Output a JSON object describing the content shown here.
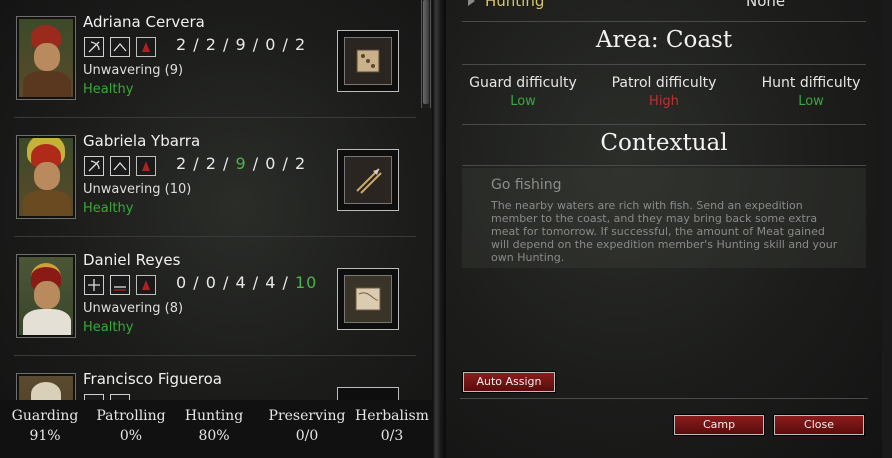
{
  "roster": [
    {
      "name": "Adriana Cervera",
      "stats": [
        "2",
        "2",
        "9",
        "0",
        "2"
      ],
      "green_stat": -1,
      "trait": "Unwavering (9)",
      "health": "Healthy",
      "item_icon": "dice-icon"
    },
    {
      "name": "Gabriela Ybarra",
      "stats": [
        "2",
        "2",
        "9",
        "0",
        "2"
      ],
      "green_stat": 2,
      "trait": "Unwavering (10)",
      "health": "Healthy",
      "item_icon": "spear-icon"
    },
    {
      "name": "Daniel Reyes",
      "stats": [
        "0",
        "0",
        "4",
        "4",
        "10"
      ],
      "green_stat": 4,
      "trait": "Unwavering (8)",
      "health": "Healthy",
      "item_icon": "map-icon"
    },
    {
      "name": "Francisco Figueroa"
    }
  ],
  "bottom_stats": [
    {
      "label": "Guarding",
      "value": "91%"
    },
    {
      "label": "Patrolling",
      "value": "0%"
    },
    {
      "label": "Hunting",
      "value": "80%"
    },
    {
      "label": "Preserving",
      "value": "0/0"
    },
    {
      "label": "Herbalism",
      "value": "0/3"
    }
  ],
  "activity": {
    "label": "Hunting",
    "value": "None"
  },
  "area": {
    "title": "Area: Coast",
    "guard": {
      "label": "Guard difficulty",
      "value": "Low"
    },
    "patrol": {
      "label": "Patrol difficulty",
      "value": "High"
    },
    "hunt": {
      "label": "Hunt difficulty",
      "value": "Low"
    }
  },
  "contextual": {
    "title": "Contextual",
    "action_name": "Go fishing",
    "description": "The nearby waters are rich with fish. Send an expedition member to the coast, and they may bring back some extra meat for tomorrow. If successful, the amount of Meat gained will depend on the expedition member's Hunting skill and your own Hunting."
  },
  "buttons": {
    "auto_assign": "Auto Assign",
    "camp": "Camp",
    "close": "Close"
  },
  "colors": {
    "healthy": "#39a939",
    "low": "#3aa83a",
    "high": "#c23030",
    "button": "#7a1818",
    "activity": "#d9c56a"
  }
}
